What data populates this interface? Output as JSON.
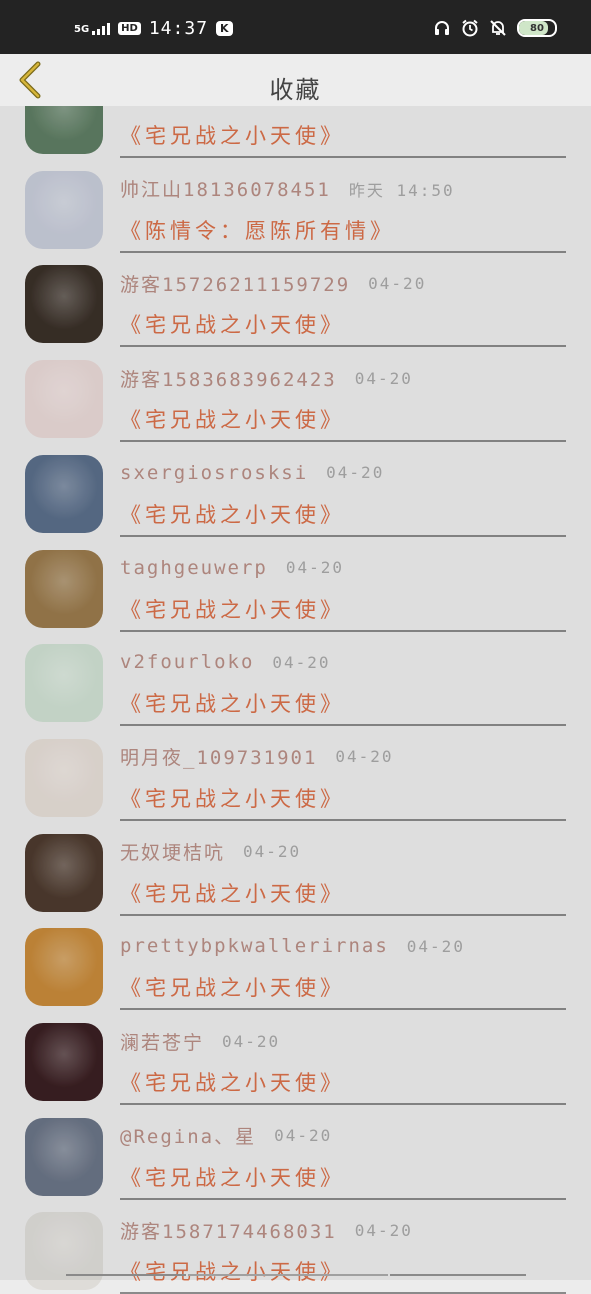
{
  "statusbar": {
    "network": "5G",
    "hd": "HD",
    "time": "14:37",
    "k": "K",
    "battery": "80",
    "battery_level": 0.8
  },
  "header": {
    "title": "收藏"
  },
  "items": [
    {
      "name": "",
      "date": "",
      "title": "《宅兄战之小天使》",
      "avatar": "#5e7d63"
    },
    {
      "name": "帅江山18136078451",
      "date": "昨天 14:50",
      "title": "《陈情令：愿陈所有情》",
      "avatar": "#c7ccd9"
    },
    {
      "name": "游客15726211159729",
      "date": "04-20",
      "title": "《宅兄战之小天使》",
      "avatar": "#3a3028"
    },
    {
      "name": "游客15836839624​23",
      "date": "04-20",
      "title": "《宅兄战之小天使》",
      "avatar": "#e8d8d6"
    },
    {
      "name": "sxergiosrosksi",
      "date": "04-20",
      "title": "《宅兄战之小天使》",
      "avatar": "#5a6e8a"
    },
    {
      "name": "taghgeuwerp",
      "date": "04-20",
      "title": "《宅兄战之小天使》",
      "avatar": "#9a7a4c"
    },
    {
      "name": "v2fourloko",
      "date": "04-20",
      "title": "《宅兄战之小天使》",
      "avatar": "#cfe0d2"
    },
    {
      "name": "明月夜_109731901",
      "date": "04-20",
      "title": "《宅兄战之小天使》",
      "avatar": "#e5ddd6"
    },
    {
      "name": "无奴埂桔吭",
      "date": "04-20",
      "title": "《宅兄战之小天使》",
      "avatar": "#4d3a2e"
    },
    {
      "name": "prettybpkwallerirnas",
      "date": "04-20",
      "title": "《宅兄战之小天使》",
      "avatar": "#c78a3a"
    },
    {
      "name": "澜若苍宁",
      "date": "04-20",
      "title": "《宅兄战之小天使》",
      "avatar": "#3a1f22"
    },
    {
      "name": "@Regina、星",
      "date": "04-20",
      "title": "《宅兄战之小天使》",
      "avatar": "#6a7486"
    },
    {
      "name": "游客15871744680​31",
      "date": "04-20",
      "title": "《宅兄战之小天使》",
      "avatar": "#dedcd8"
    }
  ]
}
